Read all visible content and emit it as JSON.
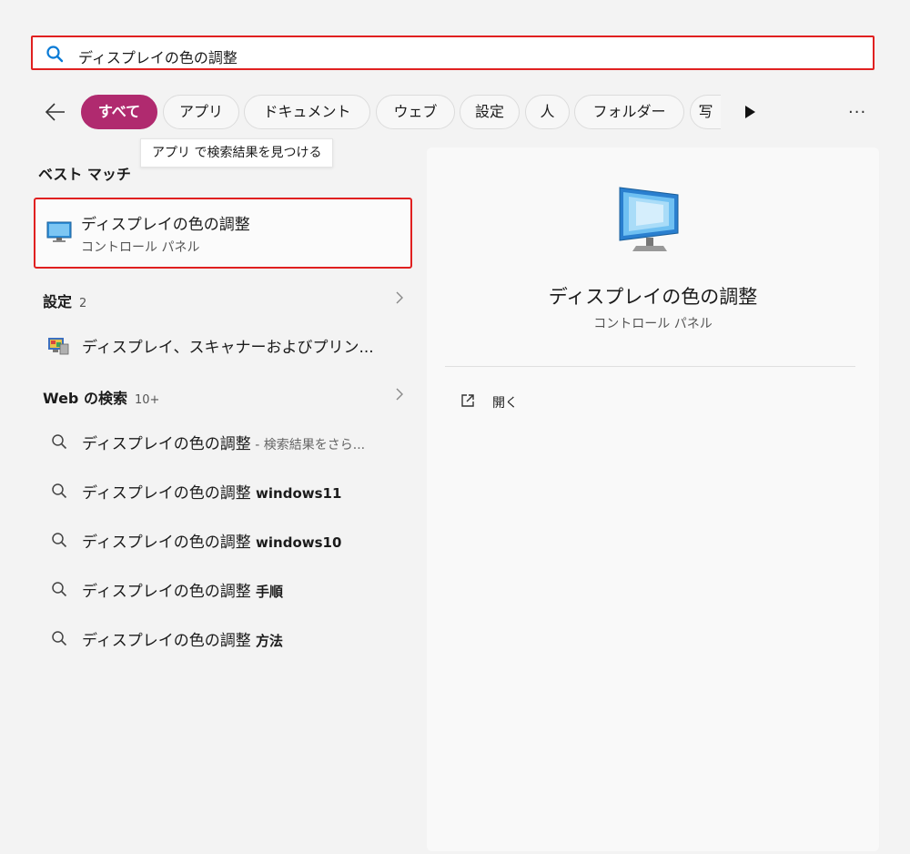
{
  "search": {
    "query": "ディスプレイの色の調整"
  },
  "filters": {
    "tabs": [
      {
        "label": "すべて",
        "active": true
      },
      {
        "label": "アプリ"
      },
      {
        "label": "ドキュメント"
      },
      {
        "label": "ウェブ"
      },
      {
        "label": "設定"
      },
      {
        "label": "人"
      },
      {
        "label": "フォルダー"
      },
      {
        "label": "写"
      }
    ],
    "more": "..."
  },
  "tooltip": "アプリ で検索結果を見つける",
  "best_match": {
    "heading": "ベスト マッチ",
    "title": "ディスプレイの色の調整",
    "subtitle": "コントロール パネル"
  },
  "settings": {
    "heading": "設定",
    "count": "2",
    "item": "ディスプレイ、スキャナーおよびプリン..."
  },
  "web": {
    "heading": "Web の検索",
    "count": "10+",
    "results": [
      {
        "base": "ディスプレイの色の調整",
        "suffix": " - 検索結果をさら...",
        "style": "dim"
      },
      {
        "base": "ディスプレイの色の調整",
        "suffix": " windows11",
        "style": "strong"
      },
      {
        "base": "ディスプレイの色の調整",
        "suffix": " windows10",
        "style": "strong"
      },
      {
        "base": "ディスプレイの色の調整",
        "suffix": " 手順",
        "style": "strong"
      },
      {
        "base": "ディスプレイの色の調整",
        "suffix": " 方法",
        "style": "strong"
      }
    ]
  },
  "preview": {
    "title": "ディスプレイの色の調整",
    "subtitle": "コントロール パネル",
    "open_label": "開く"
  },
  "colors": {
    "accent": "#b02a6f",
    "highlight_border": "#e02020",
    "search_icon": "#0a7bd6"
  }
}
